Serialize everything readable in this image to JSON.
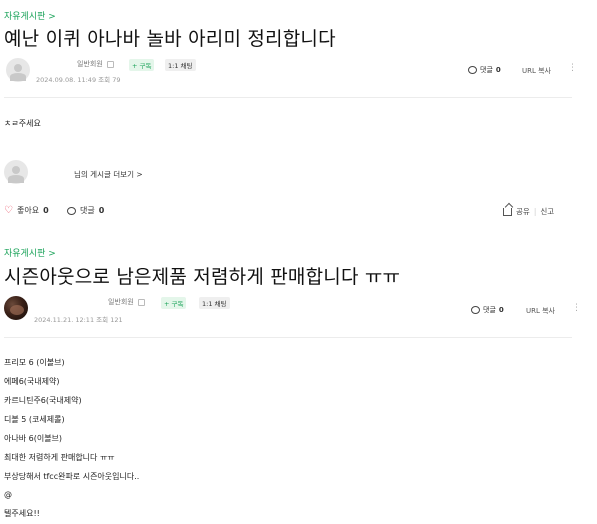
{
  "posts": [
    {
      "board": "자유게시판 >",
      "title": "예난 이퀴 아나바 놀바 아리미 정리합니다",
      "author": "일반회원",
      "subscribe": "+ 구독",
      "chat": "1:1 채팅",
      "datetime": "2024.09.08. 11:49",
      "views": "조회 79",
      "comment_label": "댓글",
      "comment_count": "0",
      "url_copy": "URL 복사",
      "body": [
        "ㅊㄹ주세요"
      ],
      "more_posts": "님의 게시글 더보기 >",
      "like_label": "좋아요",
      "like_count": "0",
      "footer_comment_label": "댓글",
      "footer_comment_count": "0",
      "share": "공유",
      "report": "신고"
    },
    {
      "board": "자유게시판 >",
      "title": "시즌아웃으로 남은제품 저렴하게 판매합니다 ㅠㅠ",
      "author": "일반회원",
      "subscribe": "+ 구독",
      "chat": "1:1 채팅",
      "datetime": "2024.11.21. 12:11",
      "views": "조회 121",
      "comment_label": "댓글",
      "comment_count": "0",
      "url_copy": "URL 복사",
      "body": [
        "프리모 6 (이볼브)",
        "에페6(국내제약)",
        "카르니틴주6(국내제약)",
        "디볼 5 (코세제롤)",
        "아나바 6(이볼브)",
        "최대한 저렴하게 판매합니다 ㅠㅠ",
        "부상당해서 tfcc완파로 시즌아웃입니다..",
        "@",
        "텔주세요!!"
      ]
    }
  ],
  "icons": {
    "comment": "comment-bubble-icon",
    "heart": "heart-outline-icon",
    "share": "share-icon",
    "more": "kebab-menu-icon",
    "grade": "member-grade-icon",
    "avatar": "default-avatar-icon"
  },
  "colors": {
    "accent_green": "#1ba35a",
    "heart_red": "#e84a5f"
  }
}
